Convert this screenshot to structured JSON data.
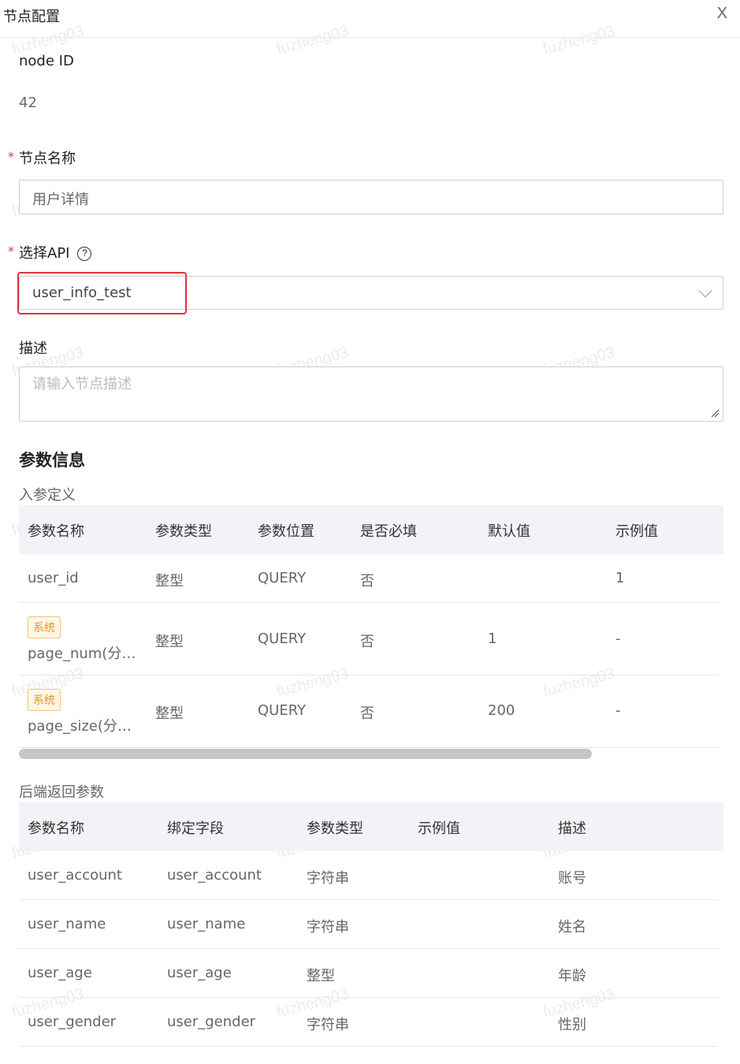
{
  "header": {
    "title": "节点配置",
    "close": "X"
  },
  "watermark": "fuzheng03",
  "node_id": {
    "label": "node ID",
    "value": "42"
  },
  "node_name": {
    "label": "节点名称",
    "value": "用户详情"
  },
  "api": {
    "label": "选择API",
    "help": "?",
    "value": "user_info_test"
  },
  "description": {
    "label": "描述",
    "placeholder": "请输入节点描述"
  },
  "params": {
    "title": "参数信息",
    "input": {
      "title": "入参定义",
      "columns": [
        "参数名称",
        "参数类型",
        "参数位置",
        "是否必填",
        "默认值",
        "示例值"
      ],
      "rows": [
        {
          "tag": "",
          "name": "user_id",
          "type": "整型",
          "position": "QUERY",
          "required": "否",
          "default": "",
          "example": "1"
        },
        {
          "tag": "系统",
          "name": "page_num(分…",
          "type": "整型",
          "position": "QUERY",
          "required": "否",
          "default": "1",
          "example": "-"
        },
        {
          "tag": "系统",
          "name": "page_size(分…",
          "type": "整型",
          "position": "QUERY",
          "required": "否",
          "default": "200",
          "example": "-"
        }
      ]
    },
    "output": {
      "title": "后端返回参数",
      "columns": [
        "参数名称",
        "绑定字段",
        "参数类型",
        "示例值",
        "描述"
      ],
      "rows": [
        {
          "name": "user_account",
          "field": "user_account",
          "type": "字符串",
          "example": "",
          "desc": "账号"
        },
        {
          "name": "user_name",
          "field": "user_name",
          "type": "字符串",
          "example": "",
          "desc": "姓名"
        },
        {
          "name": "user_age",
          "field": "user_age",
          "type": "整型",
          "example": "",
          "desc": "年龄"
        },
        {
          "name": "user_gender",
          "field": "user_gender",
          "type": "字符串",
          "example": "",
          "desc": "性别"
        }
      ]
    }
  }
}
